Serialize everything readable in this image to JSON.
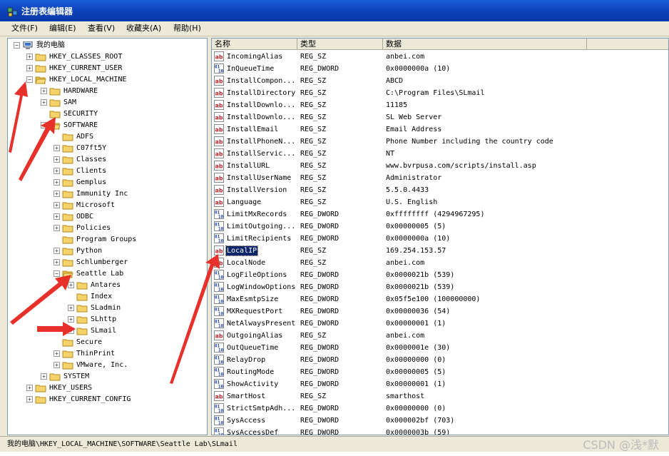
{
  "window": {
    "title": "注册表编辑器"
  },
  "menu": [
    "文件(F)",
    "编辑(E)",
    "查看(V)",
    "收藏夹(A)",
    "帮助(H)"
  ],
  "columns": {
    "name": "名称",
    "type": "类型",
    "data": "数据"
  },
  "tree": [
    {
      "label": "我的电脑",
      "level": 0,
      "expander": "-"
    },
    {
      "label": "HKEY_CLASSES_ROOT",
      "level": 1,
      "expander": "+"
    },
    {
      "label": "HKEY_CURRENT_USER",
      "level": 1,
      "expander": "+"
    },
    {
      "label": "HKEY_LOCAL_MACHINE",
      "level": 1,
      "expander": "-"
    },
    {
      "label": "HARDWARE",
      "level": 2,
      "expander": "+"
    },
    {
      "label": "SAM",
      "level": 2,
      "expander": "+"
    },
    {
      "label": "SECURITY",
      "level": 2,
      "expander": ""
    },
    {
      "label": "SOFTWARE",
      "level": 2,
      "expander": "-"
    },
    {
      "label": "ADFS",
      "level": 3,
      "expander": ""
    },
    {
      "label": "C07ft5Y",
      "level": 3,
      "expander": "+"
    },
    {
      "label": "Classes",
      "level": 3,
      "expander": "+"
    },
    {
      "label": "Clients",
      "level": 3,
      "expander": "+"
    },
    {
      "label": "Gemplus",
      "level": 3,
      "expander": "+"
    },
    {
      "label": "Immunity Inc",
      "level": 3,
      "expander": "+"
    },
    {
      "label": "Microsoft",
      "level": 3,
      "expander": "+"
    },
    {
      "label": "ODBC",
      "level": 3,
      "expander": "+"
    },
    {
      "label": "Policies",
      "level": 3,
      "expander": "+"
    },
    {
      "label": "Program Groups",
      "level": 3,
      "expander": ""
    },
    {
      "label": "Python",
      "level": 3,
      "expander": "+"
    },
    {
      "label": "Schlumberger",
      "level": 3,
      "expander": "+"
    },
    {
      "label": "Seattle Lab",
      "level": 3,
      "expander": "-"
    },
    {
      "label": "Antares",
      "level": 4,
      "expander": "+"
    },
    {
      "label": "Index",
      "level": 4,
      "expander": ""
    },
    {
      "label": "SLadmin",
      "level": 4,
      "expander": "+"
    },
    {
      "label": "SLhttp",
      "level": 4,
      "expander": "+"
    },
    {
      "label": "SLmail",
      "level": 4,
      "expander": "+"
    },
    {
      "label": "Secure",
      "level": 3,
      "expander": ""
    },
    {
      "label": "ThinPrint",
      "level": 3,
      "expander": "+"
    },
    {
      "label": "VMware, Inc.",
      "level": 3,
      "expander": "+"
    },
    {
      "label": "SYSTEM",
      "level": 2,
      "expander": "+"
    },
    {
      "label": "HKEY_USERS",
      "level": 1,
      "expander": "+"
    },
    {
      "label": "HKEY_CURRENT_CONFIG",
      "level": 1,
      "expander": "+"
    }
  ],
  "values": [
    {
      "name": "IncomingAlias",
      "type": "REG_SZ",
      "data": "anbei.com",
      "icon": "sz"
    },
    {
      "name": "InQueueTime",
      "type": "REG_DWORD",
      "data": "0x0000000a (10)",
      "icon": "dword"
    },
    {
      "name": "InstallCompon...",
      "type": "REG_SZ",
      "data": "ABCD",
      "icon": "sz"
    },
    {
      "name": "InstallDirectory",
      "type": "REG_SZ",
      "data": "C:\\Program Files\\SLmail",
      "icon": "sz"
    },
    {
      "name": "InstallDownlo...",
      "type": "REG_SZ",
      "data": "11185",
      "icon": "sz"
    },
    {
      "name": "InstallDownlo...",
      "type": "REG_SZ",
      "data": "SL Web Server",
      "icon": "sz"
    },
    {
      "name": "InstallEmail",
      "type": "REG_SZ",
      "data": "Email Address",
      "icon": "sz"
    },
    {
      "name": "InstallPhoneN...",
      "type": "REG_SZ",
      "data": "Phone Number including the country code",
      "icon": "sz"
    },
    {
      "name": "InstallServic...",
      "type": "REG_SZ",
      "data": "NT",
      "icon": "sz"
    },
    {
      "name": "InstallURL",
      "type": "REG_SZ",
      "data": "www.bvrpusa.com/scripts/install.asp",
      "icon": "sz"
    },
    {
      "name": "InstallUserName",
      "type": "REG_SZ",
      "data": "Administrator",
      "icon": "sz"
    },
    {
      "name": "InstallVersion",
      "type": "REG_SZ",
      "data": "5.5.0.4433",
      "icon": "sz"
    },
    {
      "name": "Language",
      "type": "REG_SZ",
      "data": "U.S. English",
      "icon": "sz"
    },
    {
      "name": "LimitMxRecords",
      "type": "REG_DWORD",
      "data": "0xffffffff (4294967295)",
      "icon": "dword"
    },
    {
      "name": "LimitOutgoing...",
      "type": "REG_DWORD",
      "data": "0x00000005 (5)",
      "icon": "dword"
    },
    {
      "name": "LimitRecipients",
      "type": "REG_DWORD",
      "data": "0x0000000a (10)",
      "icon": "dword"
    },
    {
      "name": "LocalIP",
      "type": "REG_SZ",
      "data": "169.254.153.57",
      "icon": "sz",
      "selected": true
    },
    {
      "name": "LocalNode",
      "type": "REG_SZ",
      "data": "anbei.com",
      "icon": "sz"
    },
    {
      "name": "LogFileOptions",
      "type": "REG_DWORD",
      "data": "0x0000021b (539)",
      "icon": "dword"
    },
    {
      "name": "LogWindowOptions",
      "type": "REG_DWORD",
      "data": "0x0000021b (539)",
      "icon": "dword"
    },
    {
      "name": "MaxEsmtpSize",
      "type": "REG_DWORD",
      "data": "0x05f5e100 (100000000)",
      "icon": "dword"
    },
    {
      "name": "MXRequestPort",
      "type": "REG_DWORD",
      "data": "0x00000036 (54)",
      "icon": "dword"
    },
    {
      "name": "NetAlwaysPresent",
      "type": "REG_DWORD",
      "data": "0x00000001 (1)",
      "icon": "dword"
    },
    {
      "name": "OutgoingAlias",
      "type": "REG_SZ",
      "data": "anbei.com",
      "icon": "sz"
    },
    {
      "name": "OutQueueTime",
      "type": "REG_DWORD",
      "data": "0x0000001e (30)",
      "icon": "dword"
    },
    {
      "name": "RelayDrop",
      "type": "REG_DWORD",
      "data": "0x00000000 (0)",
      "icon": "dword"
    },
    {
      "name": "RoutingMode",
      "type": "REG_DWORD",
      "data": "0x00000005 (5)",
      "icon": "dword"
    },
    {
      "name": "ShowActivity",
      "type": "REG_DWORD",
      "data": "0x00000001 (1)",
      "icon": "dword"
    },
    {
      "name": "SmartHost",
      "type": "REG_SZ",
      "data": "smarthost",
      "icon": "sz"
    },
    {
      "name": "StrictSmtpAdh...",
      "type": "REG_DWORD",
      "data": "0x00000000 (0)",
      "icon": "dword"
    },
    {
      "name": "SysAccess",
      "type": "REG_DWORD",
      "data": "0x000002bf (703)",
      "icon": "dword"
    },
    {
      "name": "SysAccessDef",
      "type": "REG_DWORD",
      "data": "0x0000003b (59)",
      "icon": "dword"
    }
  ],
  "status": {
    "path": "我的电脑\\HKEY_LOCAL_MACHINE\\SOFTWARE\\Seattle Lab\\SLmail"
  },
  "watermark": "CSDN @浅*默",
  "colors": {
    "titlebar": "#0a3fb5",
    "selection": "#0a246a",
    "folder": "#f4d36b",
    "arrow": "#e8302a"
  }
}
